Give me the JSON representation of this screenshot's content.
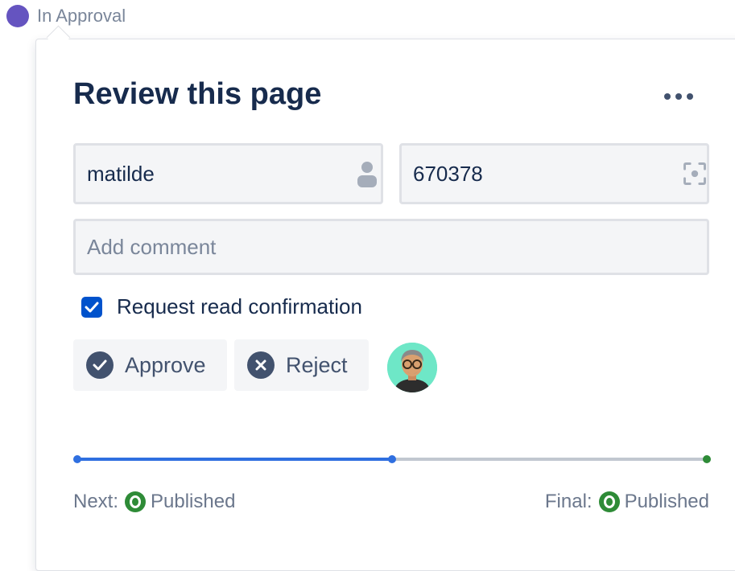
{
  "status": {
    "label": "In Approval",
    "color": "#6554c0"
  },
  "panel": {
    "title": "Review this page",
    "more_icon": "more-horizontal-icon"
  },
  "fields": {
    "user_value": "matilde",
    "user_icon": "person-icon",
    "id_value": "670378",
    "id_icon": "scan-focus-icon",
    "comment_placeholder": "Add comment"
  },
  "confirmation": {
    "label": "Request read confirmation",
    "checked": true
  },
  "actions": {
    "approve_label": "Approve",
    "approve_icon": "check-circle-icon",
    "reject_label": "Reject",
    "reject_icon": "cross-circle-icon"
  },
  "progress": {
    "fraction": 0.5,
    "fill_color": "#2f6fe0",
    "end_color": "#2e8b37"
  },
  "footer": {
    "next_label": "Next:",
    "next_state": "Published",
    "final_label": "Final:",
    "final_state": "Published",
    "state_color": "#2e8b37"
  }
}
